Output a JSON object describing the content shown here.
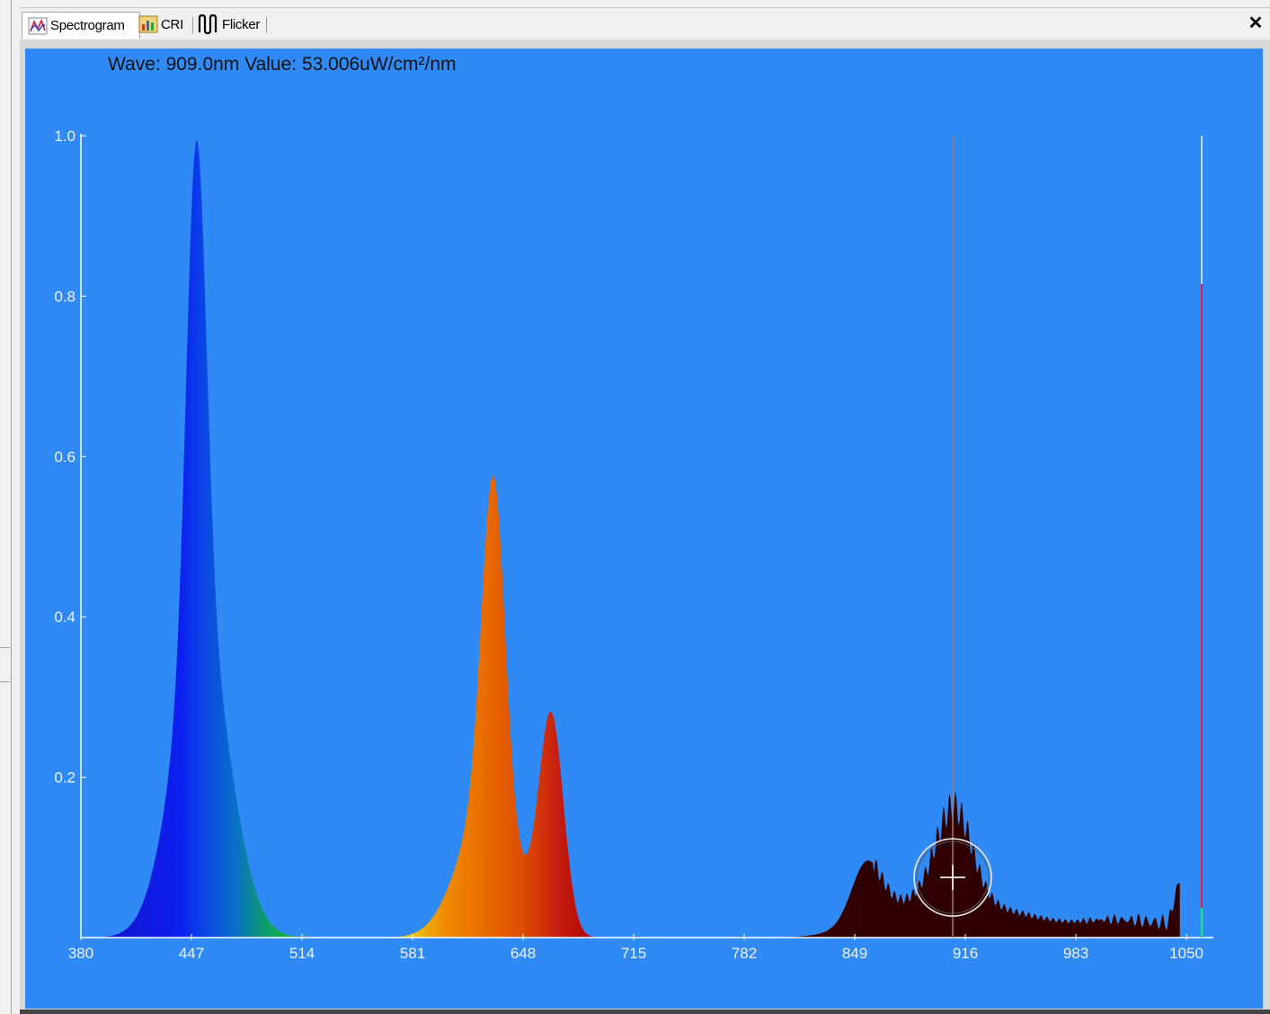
{
  "tabs": [
    {
      "label": "Spectrogram",
      "icon": "spectrogram-icon",
      "active": true
    },
    {
      "label": "CRI",
      "icon": "cri-chart-icon",
      "active": false
    },
    {
      "label": "Flicker",
      "icon": "flicker-wave-icon",
      "active": false
    }
  ],
  "close_label": "✕",
  "readout": "Wave: 909.0nm Value: 53.006uW/cm²/nm",
  "colors": {
    "plot_background": "#2f8af5",
    "axis": "#ffffff",
    "cursor_line": "#9a7a70",
    "marker_red": "#e0204a",
    "marker_green": "#22dd88"
  },
  "chart_data": {
    "type": "area",
    "x_tick_labels": [
      "380",
      "447",
      "514",
      "581",
      "648",
      "715",
      "782",
      "849",
      "916",
      "983",
      "1050"
    ],
    "y_tick_labels": [
      "0.2",
      "0.4",
      "0.6",
      "0.8",
      "1.0"
    ],
    "xlim": [
      380,
      1050
    ],
    "ylim": [
      0,
      1.0
    ],
    "grid": false,
    "cursor_wavelength": 909,
    "cursor_value": 53.006,
    "cursor_unit": "uW/cm²/nm",
    "right_marker_level": 0.815,
    "peaks": [
      {
        "x": 450,
        "y": 1.0
      },
      {
        "x": 630,
        "y": 0.58
      },
      {
        "x": 638,
        "y": 0.085
      },
      {
        "x": 665,
        "y": 0.27
      },
      {
        "x": 856,
        "y": 0.07
      },
      {
        "x": 909,
        "y": 0.155
      },
      {
        "x": 1045,
        "y": 0.05
      }
    ]
  }
}
